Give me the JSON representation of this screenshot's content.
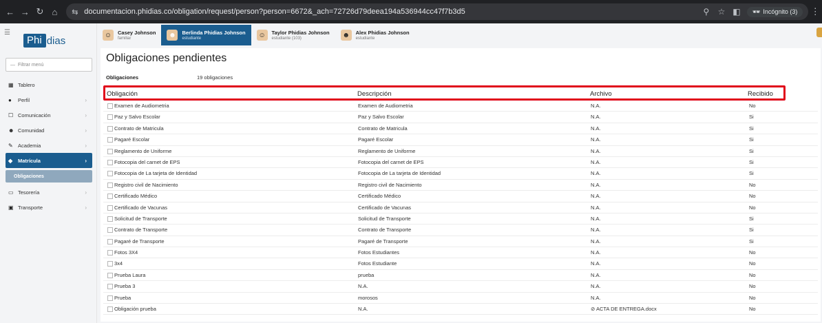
{
  "browser": {
    "url": "documentacion.phidias.co/obligation/request/person?person=6672&_ach=72726d79deea194a536944cc47f7b3d5",
    "incognito_label": "Incógnito (3)"
  },
  "sidebar": {
    "logo_mark": "Phi",
    "logo_rest": "dias",
    "filter_placeholder": "Filtrar menú",
    "items": [
      {
        "label": "Tablero",
        "icon": "dashboard-icon",
        "glyph": "▦",
        "chevron": false
      },
      {
        "label": "Perfil",
        "icon": "user-icon",
        "glyph": "●",
        "chevron": true
      },
      {
        "label": "Comunicación",
        "icon": "message-icon",
        "glyph": "☐",
        "chevron": true
      },
      {
        "label": "Comunidad",
        "icon": "community-icon",
        "glyph": "☻",
        "chevron": true
      },
      {
        "label": "Academia",
        "icon": "academy-icon",
        "glyph": "✎",
        "chevron": true
      },
      {
        "label": "Matrícula",
        "icon": "enrollment-icon",
        "glyph": "◆",
        "chevron": true,
        "active": true
      },
      {
        "label": "Tesorería",
        "icon": "treasury-icon",
        "glyph": "▭",
        "chevron": true
      },
      {
        "label": "Transporte",
        "icon": "bus-icon",
        "glyph": "▣",
        "chevron": true
      }
    ],
    "submenu_label": "Obligaciones"
  },
  "students": [
    {
      "name": "Casey Johnson",
      "role": "familiar",
      "active": false
    },
    {
      "name": "Berlinda Phidias Johnson",
      "role": "estudiante",
      "active": true
    },
    {
      "name": "Taylor Phidias Johnson",
      "role": "estudiante (103)",
      "active": false
    },
    {
      "name": "Alex Phidias Johnson",
      "role": "estudiante",
      "active": false
    }
  ],
  "main": {
    "title": "Obligaciones pendientes",
    "summary_label": "Obligaciones",
    "summary_count": "19 obligaciones",
    "columns": {
      "obligation": "Obligación",
      "description": "Descripción",
      "file": "Archivo",
      "received": "Recibido"
    },
    "rows": [
      {
        "obligation": "Examen de Audiometria",
        "description": "Examen de Audiometria",
        "file": "N.A.",
        "received": "No"
      },
      {
        "obligation": "Paz y Salvo Escolar",
        "description": "Paz y Salvo Escolar",
        "file": "N.A.",
        "received": "Si"
      },
      {
        "obligation": "Contrato de Matricula",
        "description": "Contrato de Matricula",
        "file": "N.A.",
        "received": "Si"
      },
      {
        "obligation": "Pagaré Escolar",
        "description": "Pagaré Escolar",
        "file": "N.A.",
        "received": "Si"
      },
      {
        "obligation": "Reglamento de Uniforme",
        "description": "Reglamento de Uniforme",
        "file": "N.A.",
        "received": "Si"
      },
      {
        "obligation": "Fotocopia del carnet de EPS",
        "description": "Fotocopia del carnet de EPS",
        "file": "N.A.",
        "received": "Si"
      },
      {
        "obligation": "Fotocopia de La tarjeta de Identidad",
        "description": "Fotocopia de La tarjeta de Identidad",
        "file": "N.A.",
        "received": "Si"
      },
      {
        "obligation": "Registro civil de Nacimiento",
        "description": "Registro civil de Nacimiento",
        "file": "N.A.",
        "received": "No"
      },
      {
        "obligation": "Certificado Médico",
        "description": "Certificado Médico",
        "file": "N.A.",
        "received": "No"
      },
      {
        "obligation": "Certificado de Vacunas",
        "description": "Certificado de Vacunas",
        "file": "N.A.",
        "received": "No"
      },
      {
        "obligation": "Solicitud de Transporte",
        "description": "Solicitud de Transporte",
        "file": "N.A.",
        "received": "Si"
      },
      {
        "obligation": "Contrato de Transporte",
        "description": "Contrato de Transporte",
        "file": "N.A.",
        "received": "Si"
      },
      {
        "obligation": "Pagaré de Transporte",
        "description": "Pagaré de Transporte",
        "file": "N.A.",
        "received": "Si"
      },
      {
        "obligation": "Fotos 3X4",
        "description": "Fotos Estudiantes",
        "file": "N.A.",
        "received": "No"
      },
      {
        "obligation": "3x4",
        "description": "Fotos Estudiante",
        "file": "N.A.",
        "received": "No"
      },
      {
        "obligation": "Prueba Laura",
        "description": "prueba",
        "file": "N.A.",
        "received": "No"
      },
      {
        "obligation": "Prueba 3",
        "description": "N.A.",
        "file": "N.A.",
        "received": "No"
      },
      {
        "obligation": "Prueba",
        "description": "morosos",
        "file": "N.A.",
        "received": "No"
      },
      {
        "obligation": "Obligación prueba",
        "description": "N.A.",
        "file": "ACTA DE ENTREGA.docx",
        "received": "No",
        "attachment": true
      }
    ]
  },
  "colors": {
    "brand": "#1b5d8f",
    "highlight": "#e0061a",
    "chrome": "#202124"
  }
}
